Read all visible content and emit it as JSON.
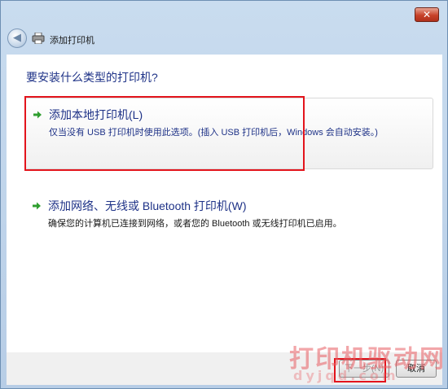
{
  "window": {
    "close_glyph": "✕"
  },
  "nav": {
    "back_glyph": "◀",
    "title": "添加打印机"
  },
  "main": {
    "heading": "要安装什么类型的打印机?",
    "options": [
      {
        "title": "添加本地打印机(L)",
        "description": "仅当没有 USB 打印机时使用此选项。(插入 USB 打印机后，Windows 会自动安装。)"
      },
      {
        "title": "添加网络、无线或 Bluetooth 打印机(W)",
        "description": "确保您的计算机已连接到网络，或者您的 Bluetooth 或无线打印机已启用。"
      }
    ]
  },
  "footer": {
    "next_label": "下一步(N)",
    "cancel_label": "取消"
  },
  "watermark": {
    "text": "打印机驱动网",
    "url": "dyjqd.com"
  },
  "colors": {
    "link_blue": "#1e3287",
    "highlight_red": "#e3141c",
    "arrow_green": "#2f9e2f"
  }
}
